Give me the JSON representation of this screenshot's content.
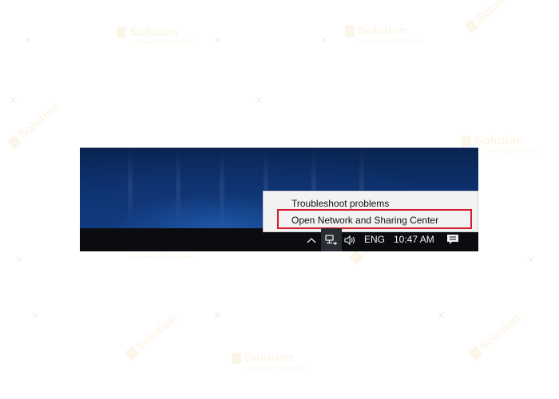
{
  "context_menu": {
    "items": [
      {
        "label": "Troubleshoot problems"
      },
      {
        "label": "Open Network and Sharing Center",
        "highlighted": true
      }
    ]
  },
  "taskbar": {
    "tray": {
      "chevron_icon": "chevron-up-icon",
      "network_icon": "network-icon",
      "volume_icon": "speaker-icon",
      "language": "ENG",
      "time": "10:47 AM",
      "notification_icon": "action-center-icon"
    }
  },
  "watermark": {
    "brand": "Solution",
    "tagline": "...."
  },
  "colors": {
    "highlight_border": "#d21f2b",
    "taskbar": "#0b0c10",
    "menu_background": "#f2f2f2",
    "watermark": "#e9c46a"
  }
}
